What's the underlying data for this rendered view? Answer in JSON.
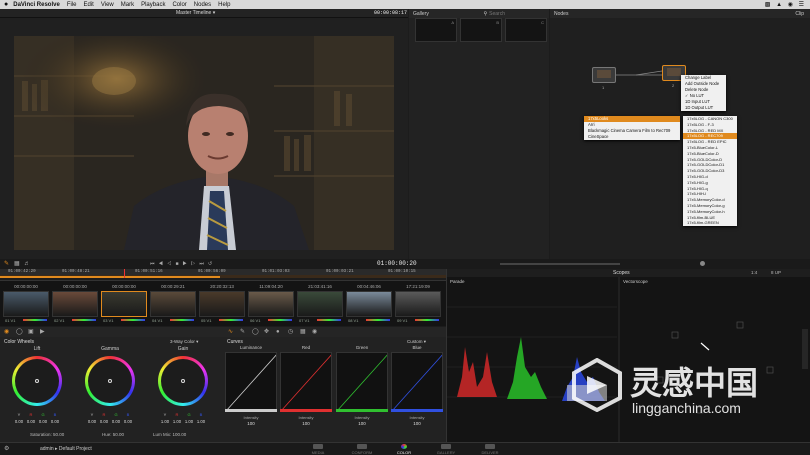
{
  "menubar": {
    "app": "DaVinci Resolve",
    "items": [
      "File",
      "Edit",
      "View",
      "Mark",
      "Playback",
      "Color",
      "Nodes",
      "Help"
    ]
  },
  "viewer": {
    "timeline_name": "Master Timeline",
    "timecode": "00:00:08:17"
  },
  "gallery": {
    "title": "Gallery",
    "search_placeholder": "Search",
    "stills": [
      "A",
      "B",
      "C"
    ]
  },
  "nodes": {
    "title": "Nodes",
    "clip_label": "Clip",
    "node1_label": "1",
    "node2_label": "2",
    "context_menu": [
      "Change Label",
      "Add Outside Node",
      "Delete Node",
      "No LUT",
      "1D Input LUT",
      "1D Output LUT"
    ],
    "lut_submenu": [
      "17x5Looks",
      "Arri",
      "Blackmagic Cinema Camera Film to Rec709",
      "CineSpace"
    ],
    "lut_list": [
      "17x5LOG - CANON C300",
      "17x5LOG - F-3",
      "17x5LOG - RED MX",
      "17x5LOG - REC709",
      "17x5LOG - RED EPIC",
      "17x5-BlueColor-L",
      "17x5-BlueColor-D",
      "17x5-GOLDColor-D",
      "17x5-GOLDColor-D1",
      "17x5-GOLDColor-D3",
      "17x5-HIG-d",
      "17x5-HIG-g",
      "17x5-HIG-q",
      "17x5-HIH-l",
      "17x5-MemoryColor-d",
      "17x5-MemoryColor-g",
      "17x5-MemoryColor-h",
      "17x5-film-BLUE",
      "17x5-film-GREEN"
    ]
  },
  "transport": {
    "timecode": "01:00:00:20"
  },
  "ruler": {
    "ticks": [
      "01:00:42:20",
      "01:00:48:21",
      "01:00:51:16",
      "01:00:56:09",
      "01:01:03:03",
      "01:00:03:21",
      "01:00:10:15"
    ]
  },
  "clips": [
    {
      "tc": "00:00:00:00",
      "label": "01  V1"
    },
    {
      "tc": "00:00:00:00",
      "label": "02  V1"
    },
    {
      "tc": "00:00:00:00",
      "label": "03  V1"
    },
    {
      "tc": "00:00:29:21",
      "label": "04  V1"
    },
    {
      "tc": "20:20:32:13",
      "label": "05  V1"
    },
    {
      "tc": "11:09:04:20",
      "label": "06  V1"
    },
    {
      "tc": "21:03:41:16",
      "label": "07  V1"
    },
    {
      "tc": "00:04:46:06",
      "label": "08  V1"
    },
    {
      "tc": "17:21:19:09",
      "label": "09  V1"
    }
  ],
  "color_wheels": {
    "title": "Color Wheels",
    "mode": "3-Way Color",
    "wheels": [
      {
        "name": "Lift",
        "values": [
          "0.00",
          "0.00",
          "0.00",
          "0.00"
        ]
      },
      {
        "name": "Gamma",
        "values": [
          "0.00",
          "0.00",
          "0.00",
          "0.00"
        ]
      },
      {
        "name": "Gain",
        "values": [
          "1.00",
          "1.00",
          "1.00",
          "1.00"
        ]
      }
    ],
    "channel_labels": [
      "Y",
      "R",
      "G",
      "B"
    ],
    "saturation": "Saturation: 50.00",
    "hue": "Hue: 50.00",
    "lum_mix": "Lum Mix: 100.00"
  },
  "curves": {
    "title": "Curves",
    "mode": "Custom",
    "channels": [
      {
        "name": "Luminance",
        "color": "#cccccc",
        "intensity_label": "Intensity",
        "intensity": "100"
      },
      {
        "name": "Red",
        "color": "#e03030",
        "intensity_label": "Intensity",
        "intensity": "100"
      },
      {
        "name": "Green",
        "color": "#30c030",
        "intensity_label": "Intensity",
        "intensity": "100"
      },
      {
        "name": "Blue",
        "color": "#3050e0",
        "intensity_label": "Intensity",
        "intensity": "100"
      }
    ]
  },
  "scopes": {
    "title": "Scopes",
    "left_label": "Parade",
    "right_label": "Vectorscope",
    "zoom": "1:4",
    "scale": "8 UP"
  },
  "bottombar": {
    "user": "admin",
    "project": "Default Project",
    "pages": [
      "MEDIA",
      "CONFORM",
      "COLOR",
      "GALLERY",
      "DELIVER"
    ],
    "active_page": "COLOR"
  },
  "watermark": {
    "cn": "灵感中国",
    "url": "lingganchina.com"
  }
}
